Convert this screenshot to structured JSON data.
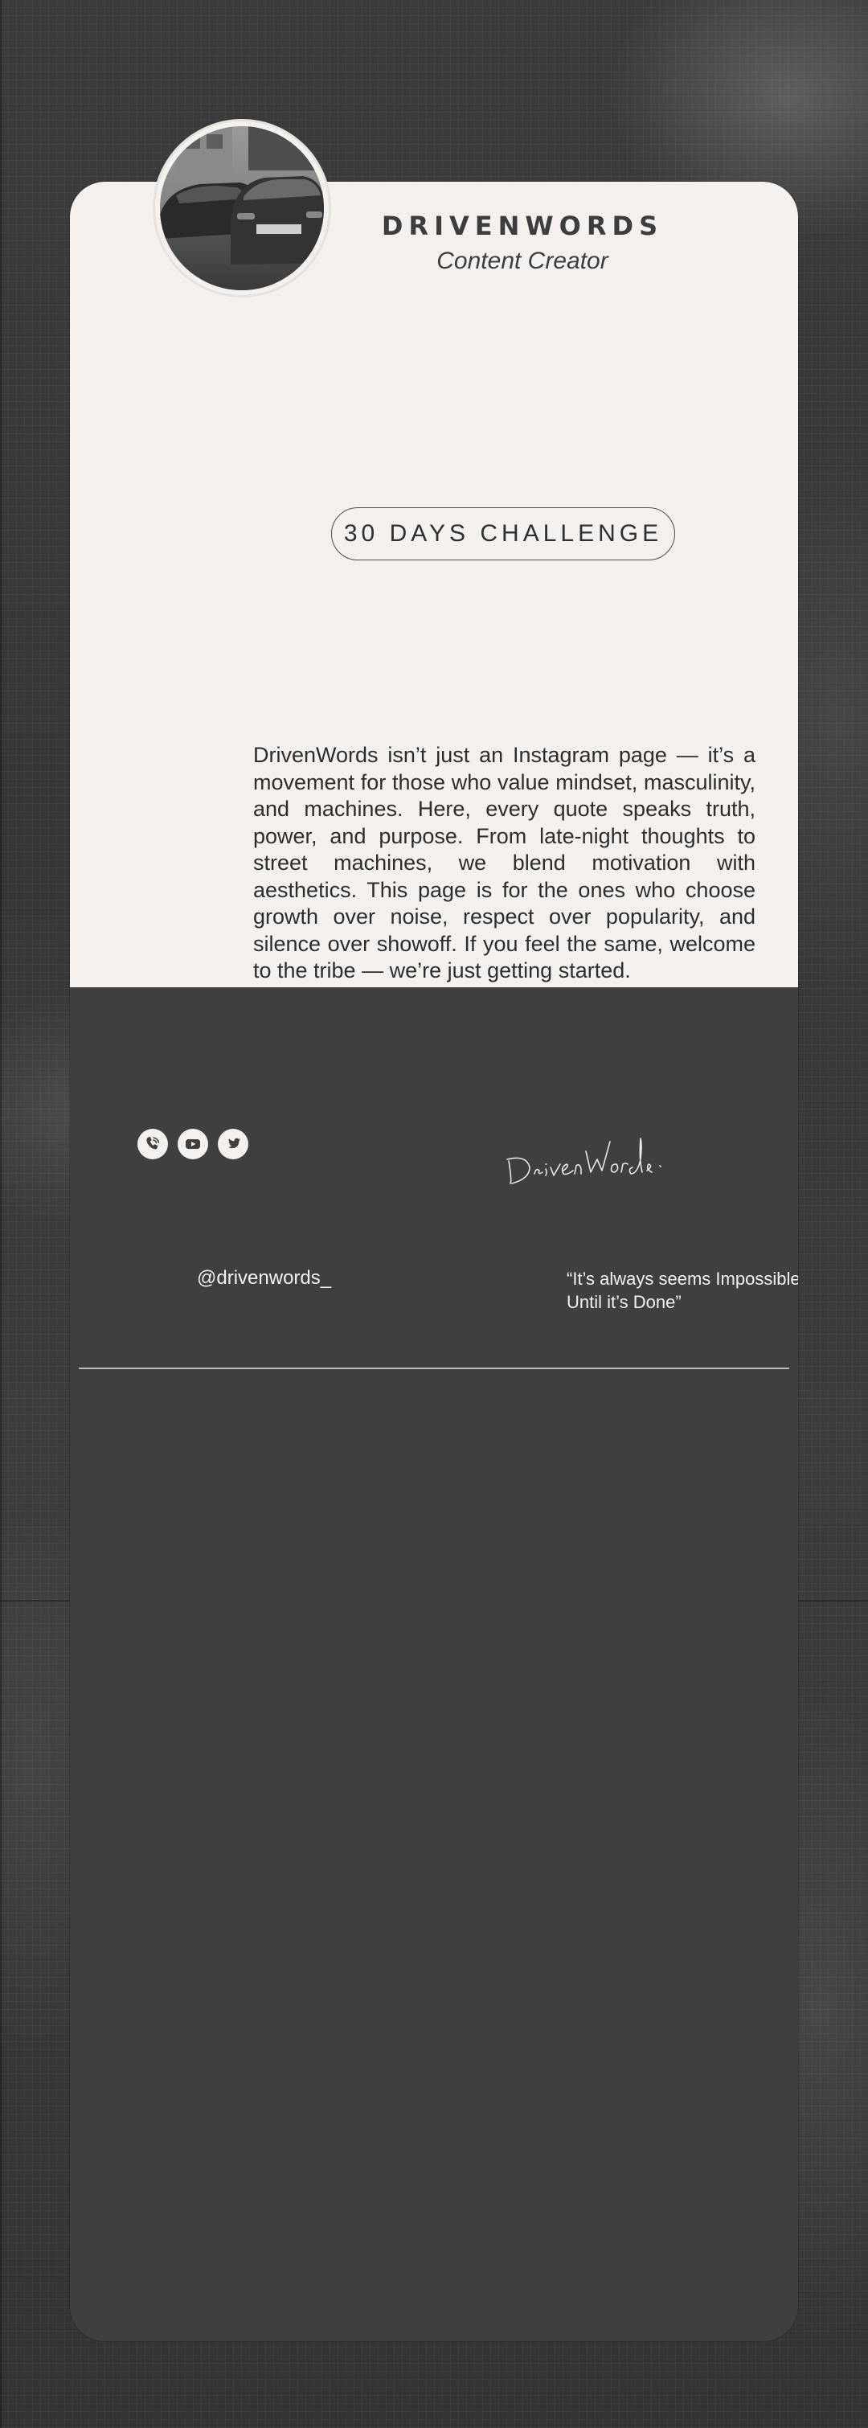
{
  "brand": {
    "name": "DRIVENWORDS",
    "role": "Content Creator"
  },
  "challenge": {
    "label": "30 DAYS CHALLENGE"
  },
  "description": {
    "text": "DrivenWords isn’t just an Instagram page — it’s a movement for those who value mindset, masculinity, and machines. Here, every quote speaks truth, power, and purpose. From late-night thoughts to street machines, we blend motivation with aesthetics. This page is for the ones who choose growth over noise, respect over popularity, and silence over showoff. If you feel the same, welcome to the tribe — we’re just getting started."
  },
  "footer": {
    "handle": "@drivenwords_",
    "quote_line1": "“It’s always seems Impossible",
    "quote_line2": "Until it’s Done”",
    "signature": "DrivenWords",
    "socials": [
      {
        "name": "phone-icon"
      },
      {
        "name": "youtube-icon"
      },
      {
        "name": "twitter-icon"
      }
    ]
  },
  "colors": {
    "card_light": "#f4f1ee",
    "card_dark": "#3f3f3f",
    "text_dark": "#2d2d2d",
    "text_light": "#f2f2f2"
  }
}
